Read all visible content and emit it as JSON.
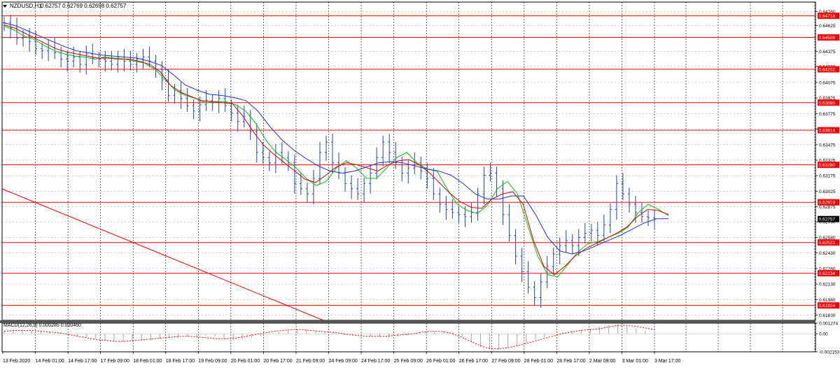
{
  "header": {
    "dropdown_icon": "triangle-down-icon",
    "symbol": "NZDUSD,H1",
    "ohlc": "0.62757 0.62769 0.62698 0.62757"
  },
  "macd_label": "MACD(12,26,9) 0.000285 0.000460",
  "price_ticks": [
    "0.64760",
    "0.64625",
    "0.64375",
    "0.64230",
    "0.64075",
    "0.63925",
    "0.63775",
    "0.63625",
    "0.63475",
    "0.63325",
    "0.63175",
    "0.63025",
    "0.62875",
    "0.62730",
    "0.62580",
    "0.62430",
    "0.62280",
    "0.62130",
    "0.61980",
    "0.61830"
  ],
  "level_labels": [
    "0.64718",
    "0.64509",
    "0.64202",
    "0.63880",
    "0.63614",
    "0.63280",
    "0.62919",
    "0.62531",
    "0.62234",
    "0.61924"
  ],
  "current_price": "0.62757",
  "macd_ticks": [
    "0.001274",
    "0.00",
    "-0.002153"
  ],
  "time_labels": [
    "13 Feb 2020",
    "14 Feb 01:00",
    "14 Feb 17:00",
    "17 Feb 09:00",
    "18 Feb 01:00",
    "18 Feb 17:00",
    "19 Feb 09:00",
    "20 Feb 01:00",
    "20 Feb 17:00",
    "21 Feb 09:00",
    "24 Feb 09:00",
    "24 Feb 17:00",
    "25 Feb 09:00",
    "26 Feb 01:00",
    "26 Feb 17:00",
    "27 Feb 09:00",
    "28 Feb 01:00",
    "28 Feb 17:00",
    "2 Mar 09:00",
    "3 Mar 01:00",
    "3 Mar 17:00"
  ],
  "chart_data": {
    "type": "line",
    "symbol": "NZDUSD",
    "timeframe": "H1",
    "ylim": [
      0.6178,
      0.6485
    ],
    "horizontal_levels": [
      0.64718,
      0.64509,
      0.64202,
      0.6388,
      0.63614,
      0.6328,
      0.62919,
      0.62531,
      0.62234,
      0.61924
    ],
    "price_bars": [
      0.6465,
      0.646,
      0.645,
      0.6452,
      0.6447,
      0.644,
      0.6438,
      0.6441,
      0.6436,
      0.643,
      0.6428,
      0.6432,
      0.6425,
      0.6435,
      0.6431,
      0.643,
      0.6428,
      0.6425,
      0.6432,
      0.6428,
      0.6425,
      0.643,
      0.6432,
      0.6428,
      0.642,
      0.641,
      0.6395,
      0.64,
      0.6392,
      0.6385,
      0.638,
      0.6386,
      0.639,
      0.6388,
      0.6392,
      0.6385,
      0.6378,
      0.637,
      0.6375,
      0.636,
      0.634,
      0.6335,
      0.633,
      0.634,
      0.6335,
      0.633,
      0.631,
      0.6305,
      0.63,
      0.6315,
      0.634,
      0.635,
      0.633,
      0.632,
      0.631,
      0.6305,
      0.63,
      0.631,
      0.632,
      0.6335,
      0.635,
      0.634,
      0.633,
      0.632,
      0.6325,
      0.633,
      0.6322,
      0.6315,
      0.63,
      0.629,
      0.6285,
      0.6282,
      0.628,
      0.6278,
      0.6282,
      0.63,
      0.6318,
      0.632,
      0.6305,
      0.628,
      0.626,
      0.624,
      0.6225,
      0.621,
      0.62,
      0.6215,
      0.623,
      0.6242,
      0.625,
      0.6255,
      0.625,
      0.6258,
      0.6262,
      0.6265,
      0.626,
      0.627,
      0.6285,
      0.631,
      0.63,
      0.629,
      0.6282,
      0.6278,
      0.6277,
      0.6276
    ],
    "moving_averages": [
      {
        "color": "#00c800",
        "values": [
          0.6462,
          0.6458,
          0.6452,
          0.6449,
          0.6443,
          0.6438,
          0.6435,
          0.6433,
          0.6432,
          0.643,
          0.6432,
          0.6431,
          0.643,
          0.6428,
          0.6426,
          0.642,
          0.641,
          0.64,
          0.6395,
          0.6392,
          0.6388,
          0.6389,
          0.6389,
          0.6386,
          0.638,
          0.6368,
          0.6352,
          0.634,
          0.6333,
          0.6325,
          0.6315,
          0.6308,
          0.6312,
          0.6325,
          0.6332,
          0.6325,
          0.6315,
          0.6315,
          0.6325,
          0.6335,
          0.634,
          0.633,
          0.6324,
          0.6322,
          0.6305,
          0.629,
          0.6284,
          0.6281,
          0.6289,
          0.6305,
          0.6312,
          0.63,
          0.627,
          0.624,
          0.6222,
          0.622,
          0.6232,
          0.6244,
          0.6252,
          0.6254,
          0.6258,
          0.6262,
          0.6268,
          0.6282,
          0.629,
          0.6285,
          0.6279
        ]
      },
      {
        "color": "#e00000",
        "values": [
          0.6463,
          0.646,
          0.6455,
          0.645,
          0.6445,
          0.644,
          0.6437,
          0.6435,
          0.6433,
          0.6431,
          0.6431,
          0.643,
          0.643,
          0.6428,
          0.6425,
          0.6418,
          0.6405,
          0.6398,
          0.6394,
          0.639,
          0.6389,
          0.6388,
          0.6387,
          0.6375,
          0.636,
          0.6347,
          0.6338,
          0.633,
          0.6322,
          0.6314,
          0.6311,
          0.6318,
          0.6326,
          0.633,
          0.6328,
          0.6325,
          0.6322,
          0.6328,
          0.6332,
          0.6333,
          0.6328,
          0.632,
          0.631,
          0.63,
          0.6292,
          0.6287,
          0.6286,
          0.6295,
          0.63,
          0.6302,
          0.629,
          0.6255,
          0.623,
          0.6222,
          0.623,
          0.624,
          0.6247,
          0.6252,
          0.6257,
          0.6262,
          0.6268,
          0.6278,
          0.6285,
          0.6284,
          0.628
        ]
      },
      {
        "color": "#2030d0",
        "values": [
          0.6465,
          0.6462,
          0.6457,
          0.6452,
          0.6447,
          0.6442,
          0.6438,
          0.6436,
          0.6434,
          0.6433,
          0.6432,
          0.6431,
          0.6428,
          0.6424,
          0.6415,
          0.6405,
          0.64,
          0.6396,
          0.6395,
          0.6393,
          0.639,
          0.638,
          0.6365,
          0.6352,
          0.6342,
          0.6334,
          0.6327,
          0.6322,
          0.632,
          0.6322,
          0.6326,
          0.633,
          0.6331,
          0.633,
          0.6327,
          0.6324,
          0.6322,
          0.6318,
          0.631,
          0.63,
          0.6295,
          0.6295,
          0.6298,
          0.6298,
          0.628,
          0.6258,
          0.6245,
          0.6242,
          0.6245,
          0.625,
          0.6255,
          0.626,
          0.6266,
          0.6272,
          0.6276,
          0.6276
        ]
      }
    ],
    "macd": {
      "label": "MACD(12,26,9)",
      "main": 0.000285,
      "signal": 0.00046,
      "ylim": [
        -0.002153,
        0.001274
      ],
      "histogram": [
        0.0004,
        0.0005,
        0.0005,
        0.0004,
        0.0003,
        0.0002,
        0.0001,
        0.0,
        -0.0002,
        -0.0004,
        -0.0006,
        -0.0008,
        -0.0009,
        -0.001,
        -0.001,
        -0.0009,
        -0.0008,
        -0.0006,
        -0.0005,
        -0.0005,
        -0.0004,
        -0.0003,
        -0.0002,
        -0.0003,
        -0.0006,
        -0.0008,
        -0.0007,
        -0.0005,
        -0.0003,
        -0.0001,
        0.0002,
        0.0004,
        0.0005,
        0.0006,
        0.0004,
        0.0003,
        0.0002,
        0.0001,
        -0.0001,
        -0.0002,
        -0.0003,
        -0.0004,
        -0.0004,
        -0.0003,
        -0.0002,
        -0.0001,
        0.0001,
        0.0003,
        0.0004,
        0.0002,
        -0.0004,
        -0.001,
        -0.0016,
        -0.0019,
        -0.0019,
        -0.0017,
        -0.0014,
        -0.0011,
        -0.0007,
        -0.0004,
        -0.0001,
        0.0002,
        0.0004,
        0.0005,
        0.0006,
        0.0008,
        0.001,
        0.0011,
        0.0009,
        0.0006,
        0.0004,
        0.0003
      ],
      "signal_line": [
        0.0003,
        0.0004,
        0.0004,
        0.0004,
        0.0003,
        0.0002,
        0.0001,
        -0.0001,
        -0.0003,
        -0.0005,
        -0.0007,
        -0.0008,
        -0.0009,
        -0.0009,
        -0.0008,
        -0.0007,
        -0.0006,
        -0.0005,
        -0.0004,
        -0.0003,
        -0.0003,
        -0.0004,
        -0.0005,
        -0.0006,
        -0.0006,
        -0.0005,
        -0.0003,
        -0.0001,
        0.0001,
        0.0003,
        0.0004,
        0.0005,
        0.0005,
        0.0004,
        0.0003,
        0.0002,
        0.0001,
        -0.0001,
        -0.0002,
        -0.0003,
        -0.0003,
        -0.0003,
        -0.0002,
        -0.0001,
        0.0,
        0.0002,
        0.0003,
        0.0003,
        0.0001,
        -0.0003,
        -0.0008,
        -0.0013,
        -0.0017,
        -0.0018,
        -0.0017,
        -0.0015,
        -0.0012,
        -0.0009,
        -0.0006,
        -0.0003,
        0.0,
        0.0002,
        0.0004,
        0.0005,
        0.0006,
        0.0008,
        0.001,
        0.001,
        0.0009,
        0.0007,
        0.0005
      ]
    }
  },
  "colors": {
    "level_line": "#ff0000",
    "level_label_bg": "#ff0000",
    "price_bar": "#2040d0",
    "macd_hist": "#a8a8a8",
    "macd_signal": "#ff0000",
    "grid": "#9a9a9a",
    "current_price_bg": "#000000"
  }
}
